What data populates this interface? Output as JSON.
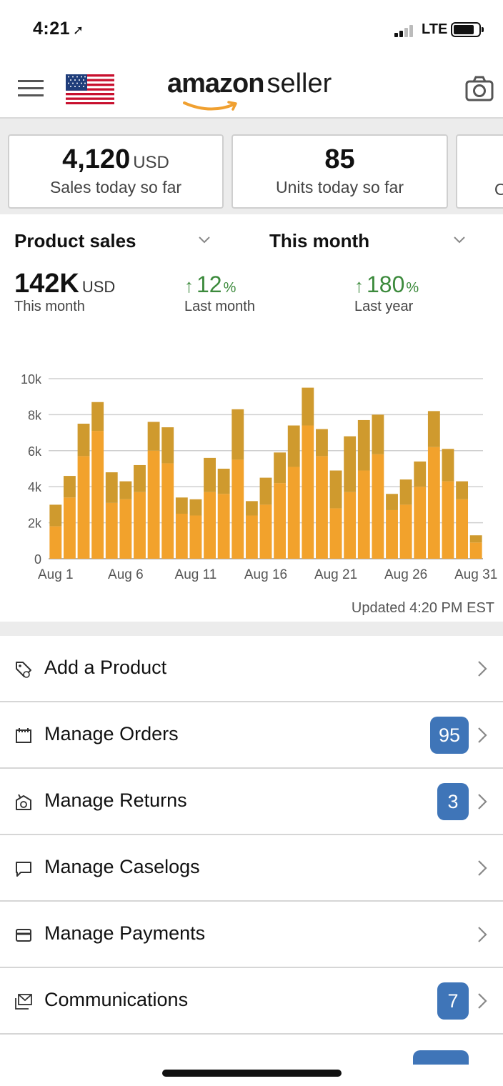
{
  "status_bar": {
    "time": "4:21",
    "network": "LTE"
  },
  "header": {
    "brand_main": "amazon",
    "brand_sub": "seller",
    "marketplace_flag": "us-flag-icon",
    "menu_icon": "menu-icon",
    "camera_icon": "camera-icon"
  },
  "summary": [
    {
      "value": "4,120",
      "unit": "USD",
      "label": "Sales today so far"
    },
    {
      "value": "85",
      "unit": "",
      "label": "Units today so far"
    },
    {
      "value": "",
      "unit": "",
      "label": "O"
    }
  ],
  "sales": {
    "metric_selector": "Product sales",
    "period_selector": "This month",
    "total_value": "142K",
    "total_unit": "USD",
    "total_label": "This month",
    "vs_last_month": {
      "value": "12",
      "pct": "%",
      "label": "Last month"
    },
    "vs_last_year": {
      "value": "180",
      "pct": "%",
      "label": "Last year"
    },
    "updated": "Updated 4:20 PM EST"
  },
  "chart_data": {
    "type": "bar",
    "stacked": true,
    "categories": [
      "Aug 1",
      "Aug 2",
      "Aug 3",
      "Aug 4",
      "Aug 5",
      "Aug 6",
      "Aug 7",
      "Aug 8",
      "Aug 9",
      "Aug 10",
      "Aug 11",
      "Aug 12",
      "Aug 13",
      "Aug 14",
      "Aug 15",
      "Aug 16",
      "Aug 17",
      "Aug 18",
      "Aug 19",
      "Aug 20",
      "Aug 21",
      "Aug 22",
      "Aug 23",
      "Aug 24",
      "Aug 25",
      "Aug 26",
      "Aug 27",
      "Aug 28",
      "Aug 29",
      "Aug 30",
      "Aug 31"
    ],
    "series": [
      {
        "color": "#f2a22c",
        "values": [
          1800,
          3400,
          5700,
          7100,
          3100,
          3300,
          3700,
          6000,
          5300,
          2500,
          2400,
          3700,
          3600,
          5500,
          2400,
          3000,
          4200,
          5100,
          7400,
          5700,
          2800,
          3700,
          4900,
          5800,
          2700,
          3000,
          4000,
          6200,
          4300,
          3300,
          900
        ]
      },
      {
        "color": "#cf9a2e",
        "values": [
          1200,
          1200,
          1800,
          1600,
          1700,
          1000,
          1500,
          1600,
          2000,
          900,
          900,
          1900,
          1400,
          2800,
          800,
          1500,
          1700,
          2300,
          2100,
          1500,
          2100,
          3100,
          2800,
          2200,
          900,
          1400,
          1400,
          2000,
          1800,
          1000,
          400
        ]
      }
    ],
    "ylim": [
      0,
      10000
    ],
    "yticks": [
      "0",
      "2k",
      "4k",
      "6k",
      "8k",
      "10k"
    ],
    "xtick_labels": [
      "Aug 1",
      "Aug 6",
      "Aug 11",
      "Aug 16",
      "Aug 21",
      "Aug 26",
      "Aug 31"
    ],
    "grid": true
  },
  "menu": [
    {
      "label": "Add a Product",
      "icon": "tag-icon",
      "badge": ""
    },
    {
      "label": "Manage Orders",
      "icon": "calendar-box-icon",
      "badge": "95"
    },
    {
      "label": "Manage Returns",
      "icon": "return-box-icon",
      "badge": "3"
    },
    {
      "label": "Manage Caselogs",
      "icon": "chat-bubble-icon",
      "badge": ""
    },
    {
      "label": "Manage Payments",
      "icon": "credit-card-icon",
      "badge": ""
    },
    {
      "label": "Communications",
      "icon": "mail-icon",
      "badge": "7"
    }
  ]
}
